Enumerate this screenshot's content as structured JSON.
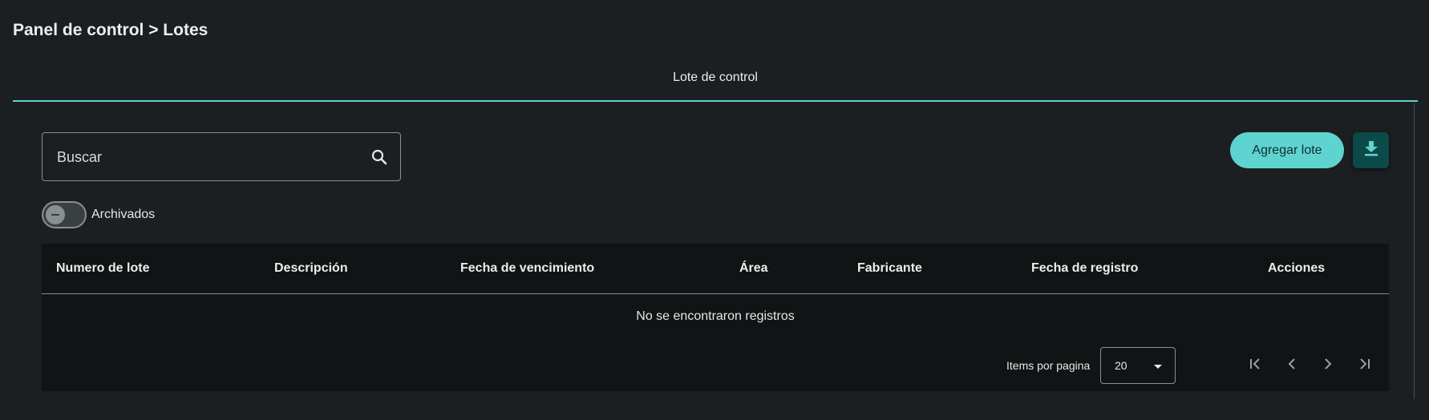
{
  "breadcrumb": "Panel de control > Lotes",
  "tabs": [
    {
      "label": "Lote de control",
      "active": true
    }
  ],
  "search": {
    "placeholder": "Buscar",
    "value": ""
  },
  "archived_toggle": {
    "label": "Archivados",
    "checked": false
  },
  "actions": {
    "add_label": "Agregar lote"
  },
  "table": {
    "columns": [
      "Numero de lote",
      "Descripción",
      "Fecha de vencimiento",
      "Área",
      "Fabricante",
      "Fecha de registro",
      "Acciones"
    ],
    "rows": [],
    "empty_message": "No se encontraron registros"
  },
  "paginator": {
    "items_per_page_label": "Items por pagina",
    "page_size": "20"
  },
  "colors": {
    "accent": "#5fd3cf",
    "background": "#1b1f21",
    "table_background": "#111314"
  }
}
